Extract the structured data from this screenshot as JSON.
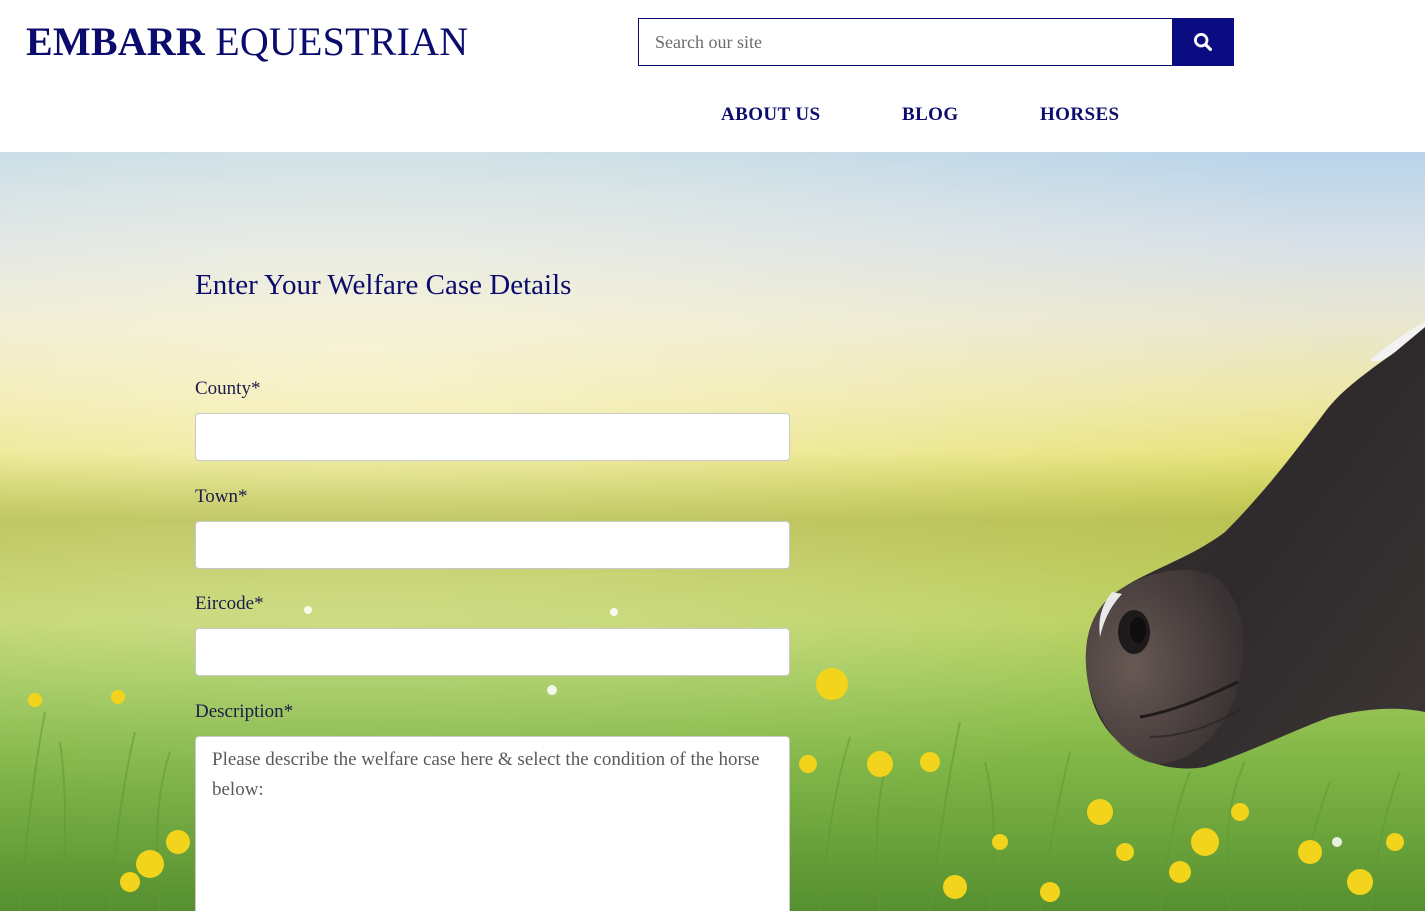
{
  "brand": {
    "bold": "EMBARR",
    "light": "EQUESTRIAN"
  },
  "search": {
    "placeholder": "Search our site",
    "icon": "search-icon"
  },
  "nav": {
    "items": [
      {
        "label": "ABOUT US"
      },
      {
        "label": "BLOG"
      },
      {
        "label": "HORSES"
      }
    ]
  },
  "form": {
    "title": "Enter Your Welfare Case Details",
    "county_label": "County*",
    "town_label": "Town*",
    "eircode_label": "Eircode*",
    "description_label": "Description*",
    "description_placeholder": "Please describe the welfare case here & select the condition of the horse below:"
  },
  "colors": {
    "brand": "#0b0b6e",
    "search_button": "#0b0b82"
  }
}
